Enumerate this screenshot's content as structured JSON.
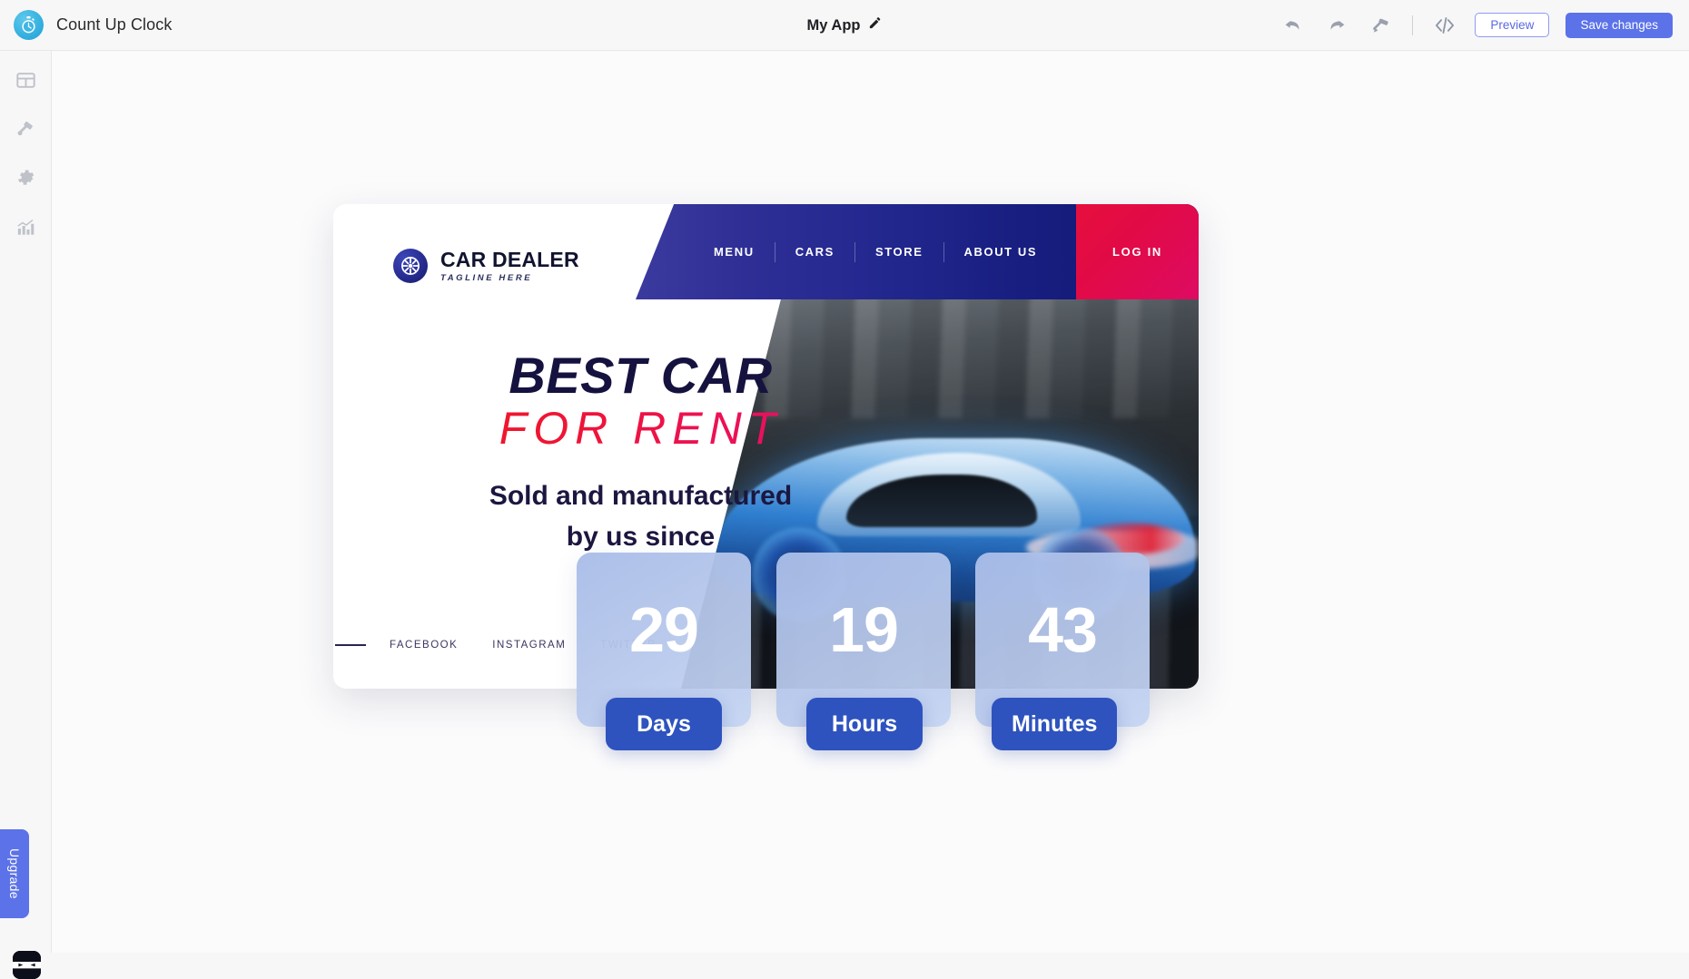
{
  "topbar": {
    "app_title": "Count Up Clock",
    "app_logo_icon": "stopwatch-icon",
    "document_title": "My App",
    "edit_icon": "pencil-icon",
    "undo_icon": "undo-arrow-icon",
    "redo_icon": "redo-arrow-icon",
    "theme_icon": "paint-roller-icon",
    "code_icon": "code-brackets-icon",
    "preview_label": "Preview",
    "save_label": "Save changes",
    "accent_color": "#5b72e8",
    "preview_border_color": "#8e9bf0"
  },
  "sidebar": {
    "items": [
      {
        "icon": "layout-grid-icon",
        "name": "layout"
      },
      {
        "icon": "paint-brush-icon",
        "name": "design"
      },
      {
        "icon": "gear-icon",
        "name": "settings"
      },
      {
        "icon": "analytics-chart-icon",
        "name": "analytics"
      }
    ],
    "upgrade_label": "Upgrade",
    "badge_icon": "ninja-face-icon"
  },
  "preview": {
    "brand": {
      "logo_icon": "wheel-icon",
      "name": "CAR DEALER",
      "tagline": "TAGLINE HERE"
    },
    "nav": {
      "links": [
        "MENU",
        "CARS",
        "STORE",
        "ABOUT US"
      ],
      "login_label": "LOG IN",
      "nav_gradient_from": "#3b3a9e",
      "nav_gradient_to": "#111a70",
      "login_gradient_from": "#e60f3c",
      "login_gradient_to": "#dd0b63"
    },
    "hero": {
      "headline_top": "BEST CAR",
      "headline_bottom": "FOR RENT",
      "subtitle_line1": "Sold and manufactured",
      "subtitle_line2": "by us since",
      "headline_top_color": "#16123f",
      "headline_bottom_gradient_from": "#f01818",
      "headline_bottom_gradient_to": "#e00d78"
    },
    "social": {
      "links": [
        "FACEBOOK",
        "INSTAGRAM",
        "TWITTER"
      ]
    },
    "photo_alt": "blue sports car in motion blur"
  },
  "countdown": {
    "card_color": "#b5c6eb",
    "label_color": "#2e53bf",
    "units": [
      {
        "value": "29",
        "label": "Days"
      },
      {
        "value": "19",
        "label": "Hours"
      },
      {
        "value": "43",
        "label": "Minutes"
      }
    ]
  }
}
